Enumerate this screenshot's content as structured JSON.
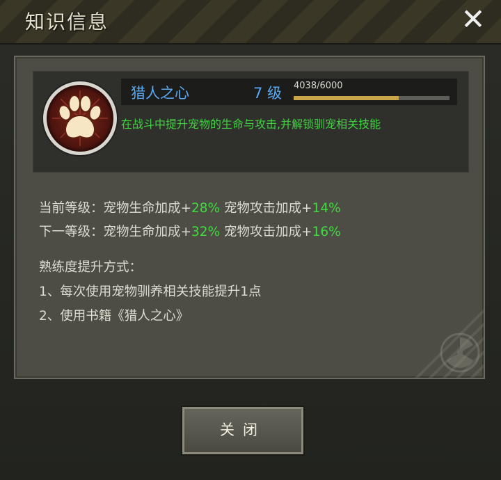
{
  "dialog": {
    "title": "知识信息",
    "close_icon": "close-icon"
  },
  "skill": {
    "name": "猎人之心",
    "level": "7 级",
    "progress_text": "4038/6000",
    "progress": 0.673,
    "description": "在战斗中提升宠物的生命与攻击,并解锁驯宠相关技能",
    "icon": "paw-icon"
  },
  "current": {
    "label": "当前等级：",
    "hp_label": "宠物生命加成+",
    "hp_value": "28%",
    "atk_label": "宠物攻击加成+",
    "atk_value": "14%"
  },
  "next": {
    "label": "下一等级：",
    "hp_label": "宠物生命加成+",
    "hp_value": "32%",
    "atk_label": "宠物攻击加成+",
    "atk_value": "16%"
  },
  "methods": {
    "heading": "熟练度提升方式：",
    "items": [
      "1、每次使用宠物驯养相关技能提升1点",
      "2、使用书籍《猎人之心》"
    ]
  },
  "footer": {
    "close_label": "关闭"
  },
  "colors": {
    "accent_blue": "#5aa9f4",
    "green": "#3edc3e",
    "progress_gold": "#c9a448"
  }
}
